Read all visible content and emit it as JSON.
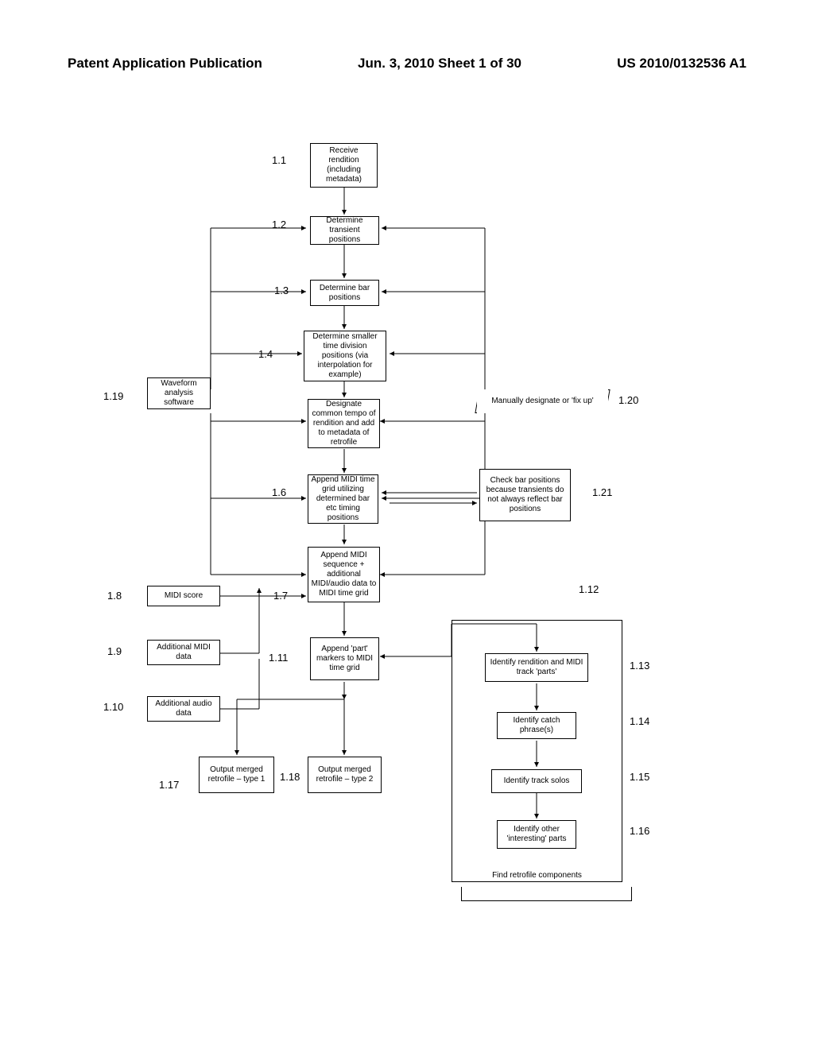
{
  "header": {
    "left": "Patent Application Publication",
    "center": "Jun. 3, 2010  Sheet 1 of 30",
    "right": "US 2010/0132536 A1"
  },
  "labels": {
    "l1_1": "1.1",
    "l1_2": "1.2",
    "l1_3": "1.3",
    "l1_4": "1.4",
    "l1_6": "1.6",
    "l1_7": "1.7",
    "l1_8": "1.8",
    "l1_9": "1.9",
    "l1_10": "1.10",
    "l1_11": "1.11",
    "l1_12": "1.12",
    "l1_13": "1.13",
    "l1_14": "1.14",
    "l1_15": "1.15",
    "l1_16": "1.16",
    "l1_17": "1.17",
    "l1_18": "1.18",
    "l1_19": "1.19",
    "l1_20": "1.20",
    "l1_21": "1.21"
  },
  "boxes": {
    "b1_1": "Receive rendition (including metadata)",
    "b1_2": "Determine transient positions",
    "b1_3": "Determine bar positions",
    "b1_4": "Determine smaller time division positions (via interpolation for example)",
    "b1_5": "Designate common tempo of rendition and add to metadata of retrofile",
    "b1_6": "Append MIDI time grid utilizing determined bar etc timing positions",
    "b1_7": "Append MIDI sequence + additional MIDI/audio data to MIDI time grid",
    "b1_8": "MIDI score",
    "b1_9": "Additional MIDI data",
    "b1_10": "Additional audio data",
    "b1_11": "Append 'part' markers to MIDI time grid",
    "b1_13": "Identify rendition and MIDI track 'parts'",
    "b1_14": "Identify catch phrase(s)",
    "b1_15": "Identify track solos",
    "b1_16": "Identify other 'interesting' parts",
    "b1_17": "Output merged retrofile – type 1",
    "b1_18": "Output merged retrofile – type 2",
    "b1_19": "Waveform analysis software",
    "b1_20": "Manually designate or 'fix up'",
    "b1_21": "Check bar positions because transients do not always reflect bar positions"
  },
  "group": {
    "g1_12": "Find retrofile components"
  }
}
